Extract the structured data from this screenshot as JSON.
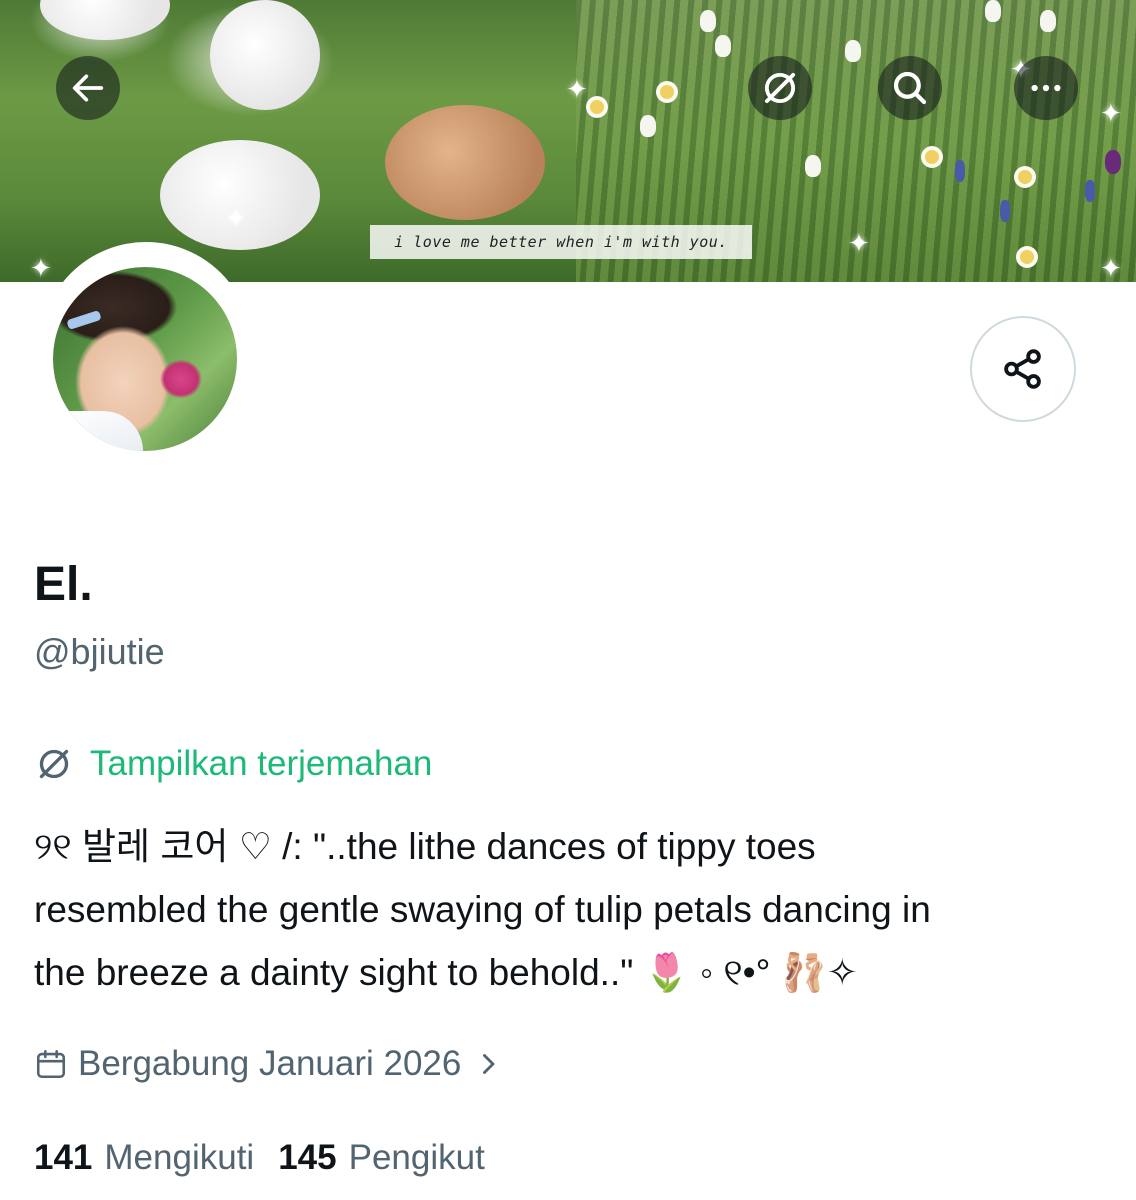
{
  "banner": {
    "caption": "i love me better when i'm with you."
  },
  "header": {
    "back_icon": "arrow-left-icon",
    "translate_icon": "translate-icon",
    "search_icon": "search-icon",
    "more_icon": "more-horizontal-icon"
  },
  "share": {
    "icon": "share-icon"
  },
  "profile": {
    "display_name": "El.",
    "handle": "@bjiutie",
    "translate_label": "Tampilkan terjemahan",
    "bio_line_1": "୨୧ 발레 코어 ♡ /: \"..the lithe dances of tippy toes",
    "bio_line_2": "resembled the gentle swaying of tulip petals dancing in",
    "bio_line_3": "the breeze a dainty sight to behold..\" 🌷 ◦ ୧•° 🩰✧",
    "joined": "Bergabung Januari 2026",
    "following_count": "141",
    "following_label": "Mengikuti",
    "followers_count": "145",
    "followers_label": "Pengikut"
  },
  "colors": {
    "accent_green": "#1db978",
    "secondary_text": "#536471",
    "primary_text": "#0f1419",
    "border": "#cfd9de"
  }
}
